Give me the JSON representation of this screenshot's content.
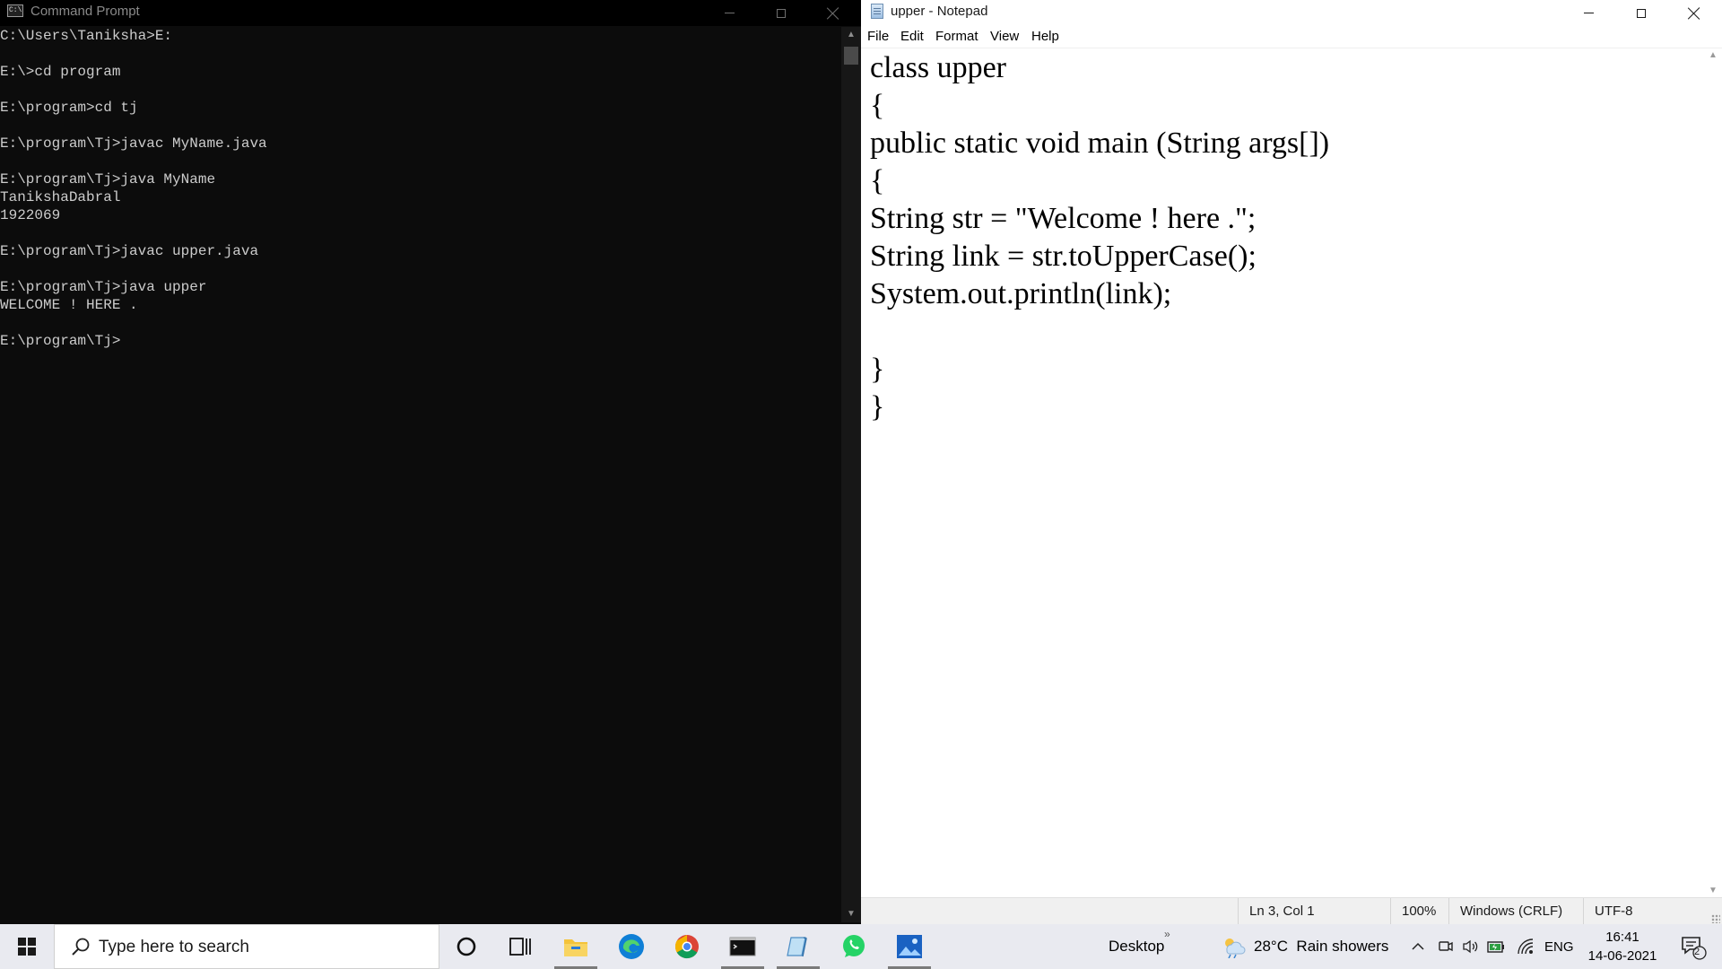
{
  "cmd": {
    "title": "Command Prompt",
    "icon": "cmd-app-icon",
    "lines": [
      "C:\\Users\\Taniksha>E:",
      "",
      "E:\\>cd program",
      "",
      "E:\\program>cd tj",
      "",
      "E:\\program\\Tj>javac MyName.java",
      "",
      "E:\\program\\Tj>java MyName",
      "TanikshaDabral",
      "1922069",
      "",
      "E:\\program\\Tj>javac upper.java",
      "",
      "E:\\program\\Tj>java upper",
      "WELCOME ! HERE .",
      "",
      "E:\\program\\Tj>"
    ]
  },
  "notepad": {
    "title": "upper - Notepad",
    "menu": [
      "File",
      "Edit",
      "Format",
      "View",
      "Help"
    ],
    "lines": [
      "class upper",
      "{",
      "public static void main (String args[])",
      "{",
      "String str = \"Welcome ! here .\";",
      "String link = str.toUpperCase();",
      "System.out.println(link);",
      "",
      "}",
      "}"
    ],
    "status": {
      "position": "Ln 3, Col 1",
      "zoom": "100%",
      "line_endings": "Windows (CRLF)",
      "encoding": "UTF-8"
    }
  },
  "taskbar": {
    "search_placeholder": "Type here to search",
    "apps": [
      "cortana-icon",
      "task-view-icon",
      "file-explorer-icon",
      "edge-icon",
      "chrome-icon",
      "command-prompt-icon",
      "notepad-icon",
      "whatsapp-icon",
      "photos-icon"
    ],
    "desktop_label": "Desktop",
    "weather": "28°C  Rain showers",
    "language": "ENG",
    "time": "16:41",
    "date": "14-06-2021",
    "notification_count": "2",
    "colors": {
      "edge": "#0f7fd6",
      "chrome_red": "#db4437",
      "chrome_yellow": "#f4b400",
      "chrome_green": "#0f9d58",
      "whatsapp": "#25d366",
      "explorer": "#f4c33a"
    }
  }
}
